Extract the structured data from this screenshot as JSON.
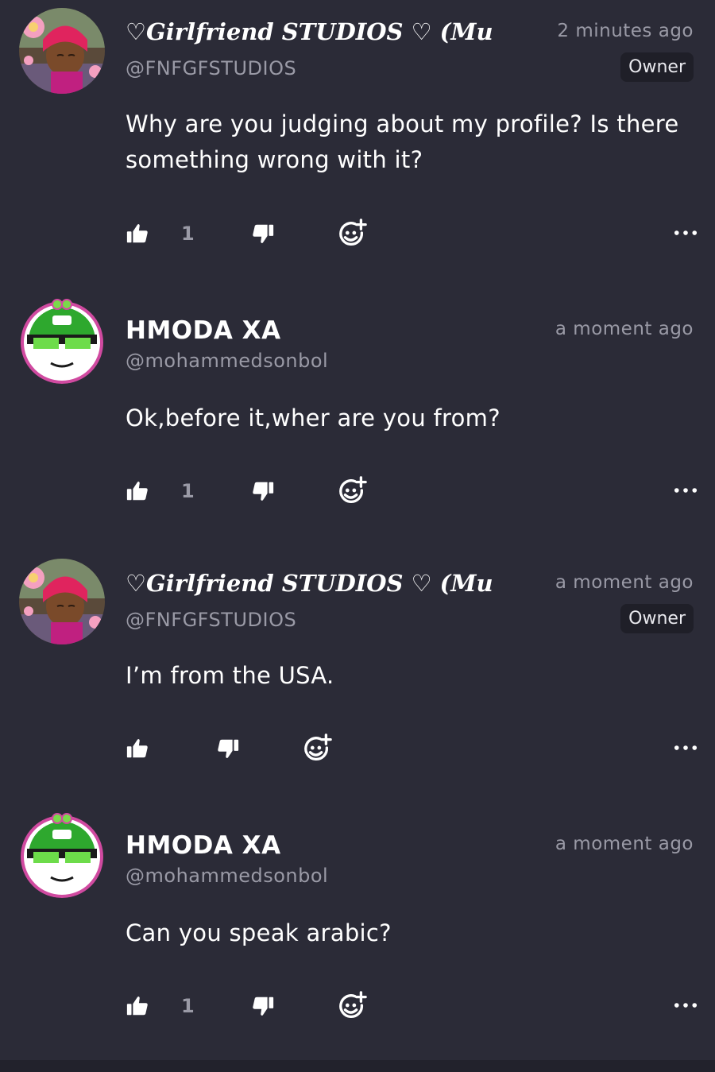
{
  "comments": [
    {
      "name": "♡𝑮𝒊𝒓𝒍𝒇𝒓𝒊𝒆𝒏𝒅 𝑺𝑻𝑼𝑫𝑰𝑶𝑺 ♡ (Mu",
      "handle": "@FNFGFSTUDIOS",
      "time": "2 minutes ago",
      "badge": "Owner",
      "text": "Why are you judging about my profile? Is there something wrong with it?",
      "likes": "1",
      "avatar": "girlfriend-avatar"
    },
    {
      "name": "HMODA XA",
      "handle": "@mohammedsonbol",
      "time": "a moment ago",
      "text": "Ok,before it,wher are you from?",
      "likes": "1",
      "avatar": "frog-avatar"
    },
    {
      "name": "♡𝑮𝒊𝒓𝒍𝒇𝒓𝒊𝒆𝒏𝒅 𝑺𝑻𝑼𝑫𝑰𝑶𝑺 ♡ (Mu",
      "handle": "@FNFGFSTUDIOS",
      "time": "a moment ago",
      "badge": "Owner",
      "text": "I’m from the USA.",
      "avatar": "girlfriend-avatar"
    },
    {
      "name": "HMODA XA",
      "handle": "@mohammedsonbol",
      "time": "a moment ago",
      "text": "Can you speak arabic?",
      "likes": "1",
      "avatar": "frog-avatar"
    }
  ],
  "icons": {
    "like": "thumbs-up-icon",
    "dislike": "thumbs-down-icon",
    "react": "add-reaction-icon",
    "more": "more-options-icon"
  },
  "colors": {
    "background": "#2b2b37",
    "secondary_text": "#9a9aa6",
    "badge_bg": "#1f1f28"
  }
}
